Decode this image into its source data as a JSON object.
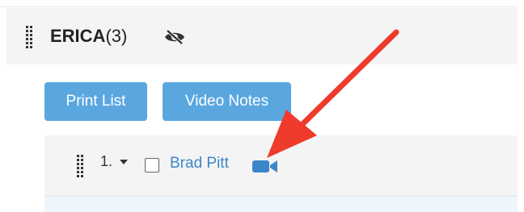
{
  "group": {
    "name": "ERICA",
    "count": "(3)",
    "hidden_icon": "eye-slash-icon"
  },
  "toolbar": {
    "print_label": "Print List",
    "video_notes_label": "Video Notes"
  },
  "list": {
    "items": [
      {
        "number": "1.",
        "name": "Brad Pitt",
        "checked": false,
        "icon": "video-camera-icon"
      }
    ]
  },
  "colors": {
    "button": "#5aa7e0",
    "link": "#3b86c9",
    "arrow": "#ee3b2b",
    "row_bg": "#f4f4f4"
  }
}
